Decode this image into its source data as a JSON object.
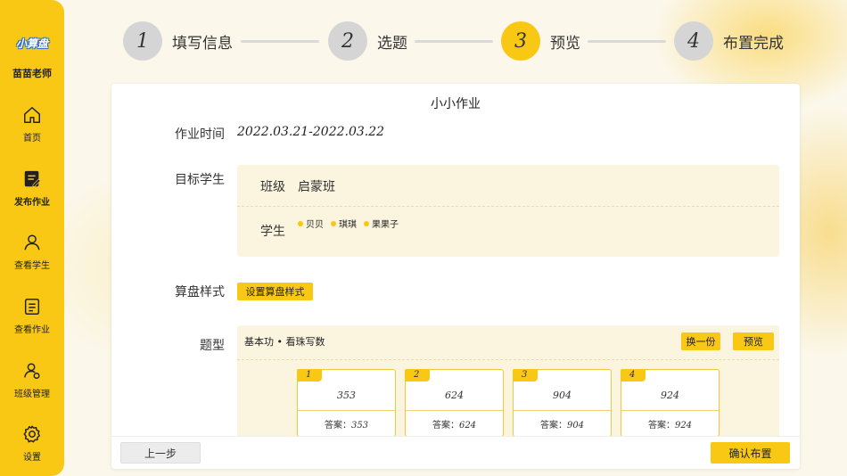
{
  "sidebar": {
    "logo_text": "小算盘",
    "teacher_name": "苗苗老师",
    "items": [
      {
        "label": "首页",
        "icon": "home-icon"
      },
      {
        "label": "发布作业",
        "icon": "publish-icon"
      },
      {
        "label": "查看学生",
        "icon": "user-icon"
      },
      {
        "label": "查看作业",
        "icon": "document-icon"
      },
      {
        "label": "班级管理",
        "icon": "class-icon"
      },
      {
        "label": "设置",
        "icon": "gear-icon"
      }
    ]
  },
  "stepper": {
    "steps": [
      {
        "number": "1",
        "label": "填写信息"
      },
      {
        "number": "2",
        "label": "选题"
      },
      {
        "number": "3",
        "label": "预览"
      },
      {
        "number": "4",
        "label": "布置完成"
      }
    ],
    "active_step": 3
  },
  "form": {
    "title": "小小作业",
    "time_label": "作业时间",
    "time_value": "2022.03.21-2022.03.22",
    "target_label": "目标学生",
    "class_label": "班级",
    "class_value": "启蒙班",
    "students_label": "学生",
    "students": [
      "贝贝",
      "琪琪",
      "果果子"
    ],
    "abacus_label": "算盘样式",
    "abacus_button": "设置算盘样式",
    "qtype_label": "题型",
    "qtype_title": "基本功 • 看珠写数",
    "swap_button": "换一份",
    "preview_button": "预览",
    "answer_prefix": "答案：",
    "questions": [
      {
        "number": "1",
        "value": "353",
        "answer": "353"
      },
      {
        "number": "2",
        "value": "624",
        "answer": "624"
      },
      {
        "number": "3",
        "value": "904",
        "answer": "904"
      },
      {
        "number": "4",
        "value": "924",
        "answer": "924"
      }
    ]
  },
  "footer": {
    "prev_button": "上一步",
    "confirm_button": "确认布置"
  },
  "colors": {
    "accent": "#f8c815",
    "panel": "#fbf4de",
    "inactive_step": "#d5d5d5"
  }
}
